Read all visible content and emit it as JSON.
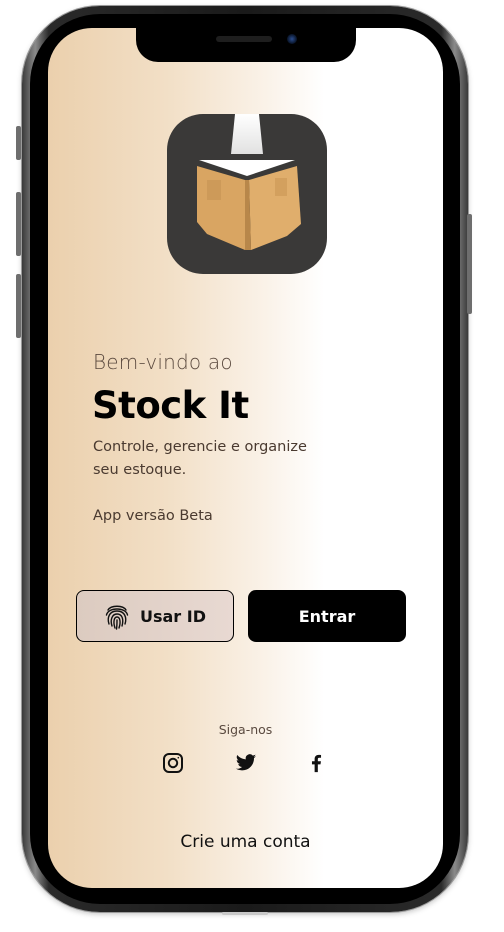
{
  "welcome": {
    "greeting": "Bem-vindo ao",
    "app_name": "Stock It",
    "description": "Controle, gerencie e organize seu estoque.",
    "version": "App versão Beta"
  },
  "buttons": {
    "use_id_label": "Usar ID",
    "enter_label": "Entrar"
  },
  "social": {
    "heading": "Siga-nos",
    "icons": [
      "instagram-icon",
      "twitter-icon",
      "facebook-icon"
    ]
  },
  "footer": {
    "create_account": "Crie uma conta"
  },
  "colors": {
    "gradient_start": "#ebd0ad",
    "primary_button": "#000000",
    "logo_background": "#3a3938",
    "box_color": "#d9a562"
  }
}
